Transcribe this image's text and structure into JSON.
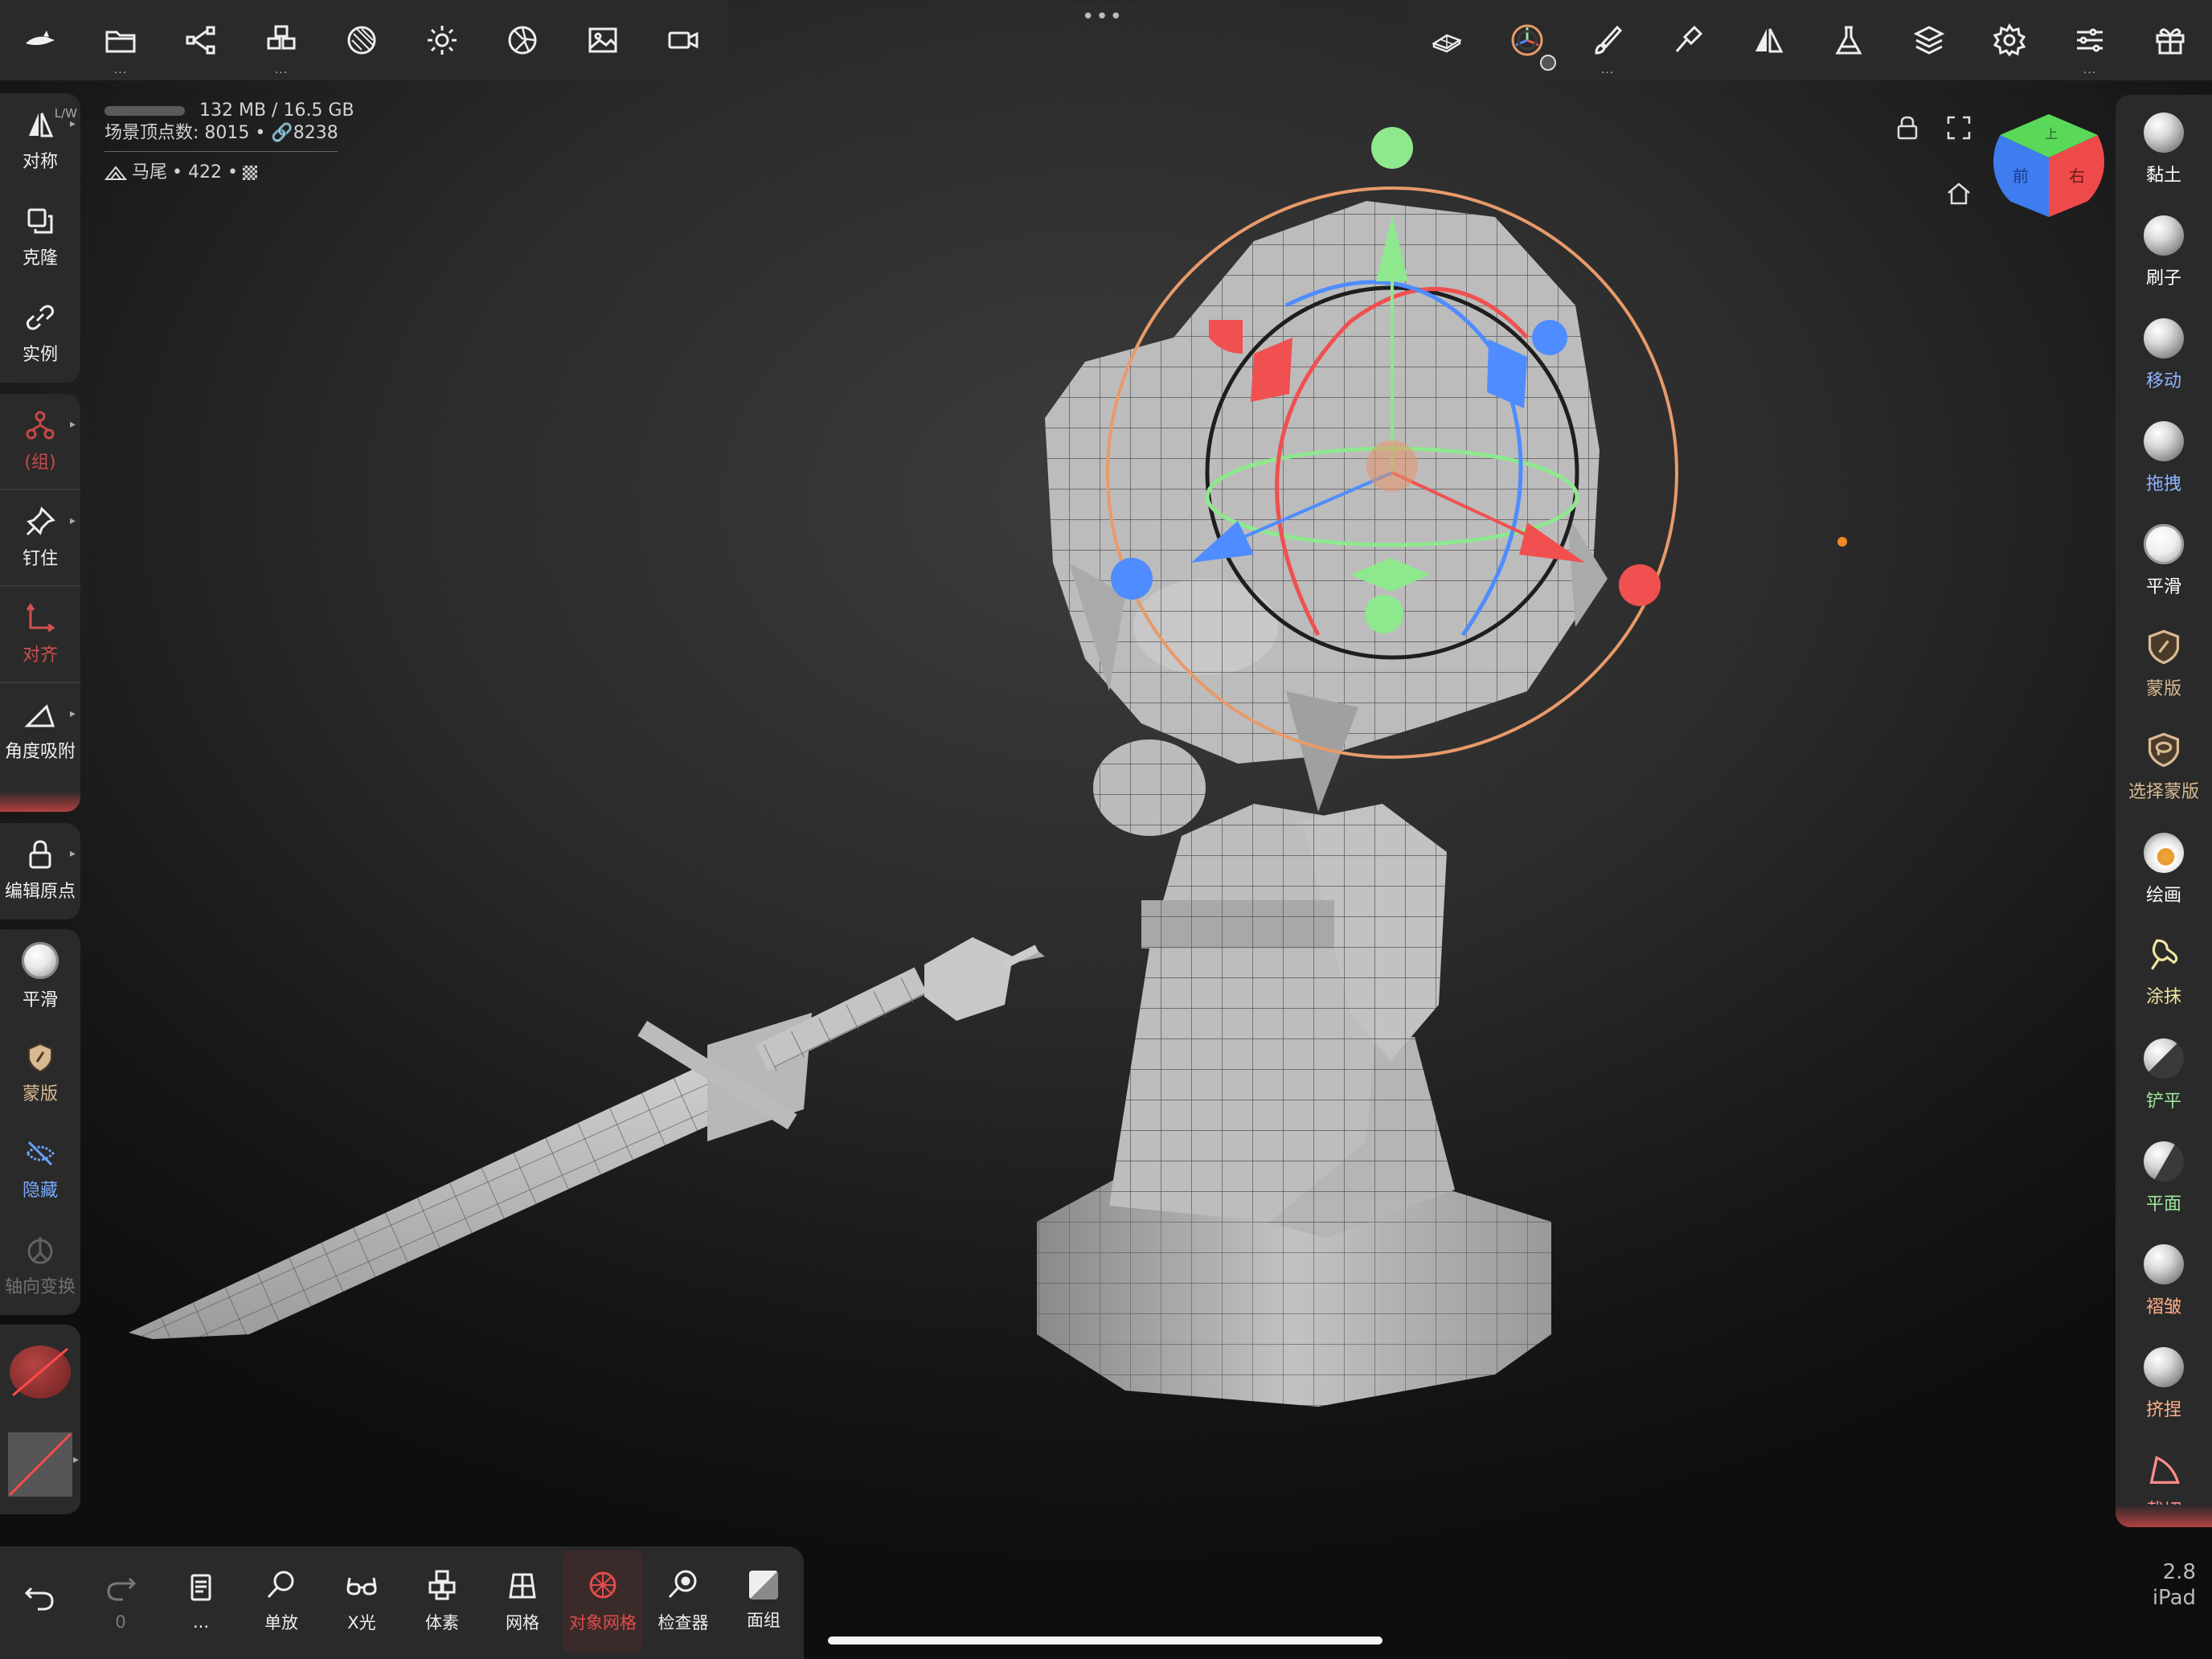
{
  "top_left_toolbar": {
    "icons": [
      "nomad-logo-icon",
      "folder-icon",
      "scene-graph-icon",
      "primitives-icon",
      "background-icon",
      "light-icon",
      "material-icon",
      "image-icon",
      "video-icon"
    ],
    "dots": "..."
  },
  "top_center": {
    "handle": "•••"
  },
  "top_right_toolbar": {
    "icons": [
      "mesh-tool-icon",
      "gizmo-icon",
      "brush-icon",
      "paint-icon",
      "symmetry-icon",
      "flask-icon",
      "layers-icon",
      "settings-icon",
      "sliders-icon",
      "gift-icon"
    ],
    "dots": "..."
  },
  "stats": {
    "memory": "132 MB / 16.5 GB",
    "scene_vertices": "场景顶点数: 8015 • ",
    "link_count": "8238",
    "object_name": "马尾",
    "object_count": " • 422 • "
  },
  "left_panel": {
    "lw_label": "L/W",
    "items": [
      {
        "label": "对称",
        "icon": "symmetry-icon"
      },
      {
        "label": "克隆",
        "icon": "clone-icon"
      },
      {
        "label": "实例",
        "icon": "link-icon"
      },
      {
        "label": "(组)",
        "icon": "group-icon"
      },
      {
        "label": "钉住",
        "icon": "pin-icon"
      },
      {
        "label": "对齐",
        "icon": "align-icon"
      },
      {
        "label": "角度吸附",
        "icon": "angle-snap-icon"
      },
      {
        "label": "编辑原点",
        "icon": "lock-icon"
      },
      {
        "label": "平滑",
        "icon": "smooth-icon"
      },
      {
        "label": "蒙版",
        "icon": "mask-icon"
      },
      {
        "label": "隐藏",
        "icon": "hide-icon"
      },
      {
        "label": "轴向变换",
        "icon": "axis-transform-icon"
      }
    ]
  },
  "right_panel": {
    "items": [
      {
        "label": "黏土",
        "color": "#ffffff"
      },
      {
        "label": "刷子",
        "color": "#ffffff"
      },
      {
        "label": "移动",
        "color": "#8fb4ff"
      },
      {
        "label": "拖拽",
        "color": "#8fb4ff"
      },
      {
        "label": "平滑",
        "color": "#ffffff"
      },
      {
        "label": "蒙版",
        "color": "#d8b992"
      },
      {
        "label": "选择蒙版",
        "color": "#d8b992"
      },
      {
        "label": "绘画",
        "color": "#ffffff"
      },
      {
        "label": "涂抹",
        "color": "#f0e6a0"
      },
      {
        "label": "铲平",
        "color": "#9fe49f"
      },
      {
        "label": "平面",
        "color": "#9fe49f"
      },
      {
        "label": "褶皱",
        "color": "#ffb08a"
      },
      {
        "label": "挤捏",
        "color": "#ffb08a"
      },
      {
        "label": "裁切",
        "color": "#ff8a8a"
      }
    ]
  },
  "bottom_toolbar": {
    "items": [
      {
        "label": "",
        "icon": "undo-icon"
      },
      {
        "label": "0",
        "icon": "redo-icon"
      },
      {
        "label": "...",
        "icon": "history-icon"
      },
      {
        "label": "单放",
        "icon": "isolate-icon"
      },
      {
        "label": "X光",
        "icon": "xray-icon"
      },
      {
        "label": "体素",
        "icon": "voxel-icon"
      },
      {
        "label": "网格",
        "icon": "wireframe-icon"
      },
      {
        "label": "对象网格",
        "icon": "object-wireframe-icon"
      },
      {
        "label": "检查器",
        "icon": "inspector-icon"
      },
      {
        "label": "面组",
        "icon": "facegroup-icon"
      }
    ]
  },
  "viewcube": {
    "front": "前",
    "right": "右",
    "top": "上"
  },
  "version": {
    "number": "2.8",
    "device": "iPad"
  },
  "colors": {
    "accent_red": "#e24b4b",
    "panel_bg": "#2a2a2a",
    "gizmo_orange": "#e89a6a",
    "gizmo_green": "#8ee88e",
    "gizmo_red": "#f05050",
    "gizmo_blue": "#4f8cff"
  }
}
